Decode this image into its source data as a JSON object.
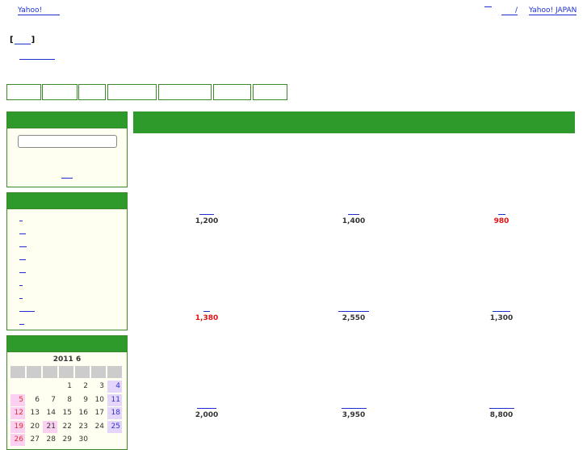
{
  "header": {
    "yahoo_link": "Yahoo!",
    "right_links": [
      "",
      "/",
      "Yahoo! JAPAN"
    ],
    "bracket_open": "[",
    "bracket_close": "]"
  },
  "calendar": {
    "title": "2011 6",
    "weeks": [
      [
        "",
        "",
        "",
        "1",
        "2",
        "3",
        "4"
      ],
      [
        "5",
        "6",
        "7",
        "8",
        "9",
        "10",
        "11"
      ],
      [
        "12",
        "13",
        "14",
        "15",
        "16",
        "17",
        "18"
      ],
      [
        "19",
        "20",
        "21",
        "22",
        "23",
        "24",
        "25"
      ],
      [
        "26",
        "27",
        "28",
        "29",
        "30",
        "",
        ""
      ]
    ]
  },
  "products": [
    {
      "price": "1,200",
      "sale": false
    },
    {
      "price": "1,400",
      "sale": false
    },
    {
      "price": "980",
      "sale": true
    },
    {
      "price": "1,380",
      "sale": true
    },
    {
      "price": "2,550",
      "sale": false
    },
    {
      "price": "1,300",
      "sale": false
    },
    {
      "price": "2,000",
      "sale": false
    },
    {
      "price": "3,950",
      "sale": false
    },
    {
      "price": "8,800",
      "sale": false
    }
  ],
  "colors": {
    "green": "#2f9a2c",
    "link": "#1e2fcf",
    "sale_price": "#e01010"
  }
}
